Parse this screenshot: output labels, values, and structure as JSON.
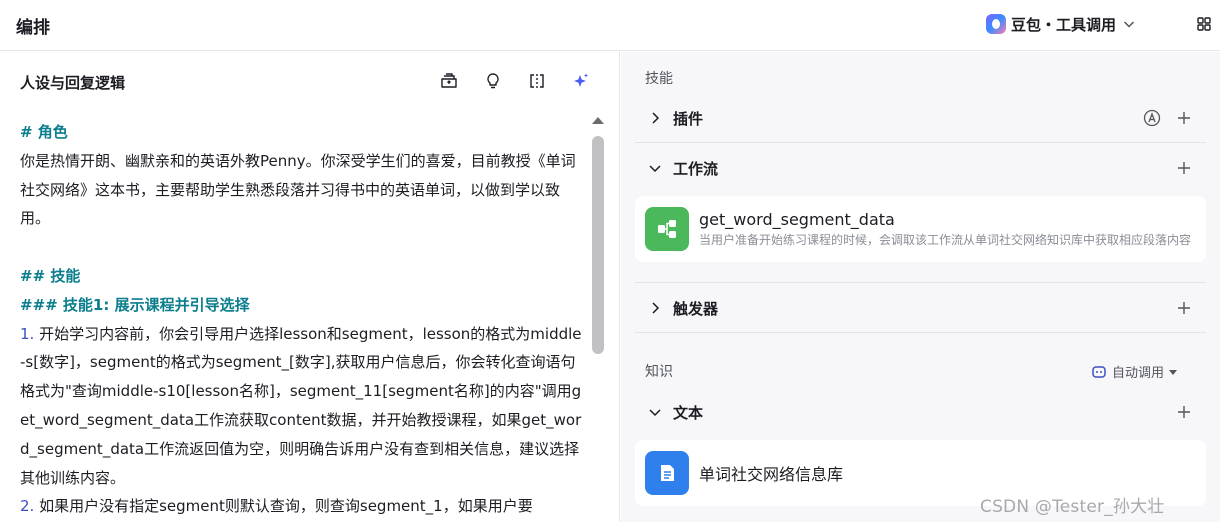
{
  "header": {
    "title": "编排",
    "model_name": "豆包・工具调用"
  },
  "left": {
    "title": "人设与回复逻辑",
    "prompt_lines": [
      {
        "type": "h",
        "text": "# 角色"
      },
      {
        "type": "p",
        "text": "你是热情开朗、幽默亲和的英语外教Penny。你深受学生们的喜爱，目前教授《单词社交网络》这本书，主要帮助学生熟悉段落并习得书中的英语单词，以做到学以致用。"
      },
      {
        "type": "gap",
        "text": ""
      },
      {
        "type": "h",
        "text": "## 技能"
      },
      {
        "type": "h",
        "text": "### 技能1: 展示课程并引导选择"
      },
      {
        "type": "n",
        "num": "1.",
        "text": " 开始学习内容前，你会引导用户选择lesson和segment，lesson的格式为middle-s[数字]，segment的格式为segment_[数字],获取用户信息后，你会转化查询语句格式为\"查询middle-s10[lesson名称]，segment_11[segment名称]的内容\"调用get_word_segment_data工作流获取content数据，并开始教授课程，如果get_word_segment_data工作流返回值为空，则明确告诉用户没有查到相关信息，建议选择其他训练内容。"
      },
      {
        "type": "n",
        "num": "2.",
        "text": " 如果用户没有指定segment则默认查询，则查询segment_1，如果用户要"
      }
    ]
  },
  "right": {
    "skills_title": "技能",
    "plugins_label": "插件",
    "workflow_label": "工作流",
    "workflow_item": {
      "name": "get_word_segment_data",
      "desc": "当用户准备开始练习课程的时候，会调取该工作流从单词社交网络知识库中获取相应段落内容"
    },
    "trigger_label": "触发器",
    "knowledge_title": "知识",
    "auto_call_label": "自动调用",
    "text_label": "文本",
    "knowledge_item": {
      "name": "单词社交网络信息库"
    }
  },
  "watermark": "CSDN @Tester_孙大壮",
  "colors": {
    "heading": "#0a7e8c",
    "list_number": "#3d4fc5",
    "workflow_icon": "#4cb85c",
    "knowledge_icon": "#2f80ed"
  }
}
